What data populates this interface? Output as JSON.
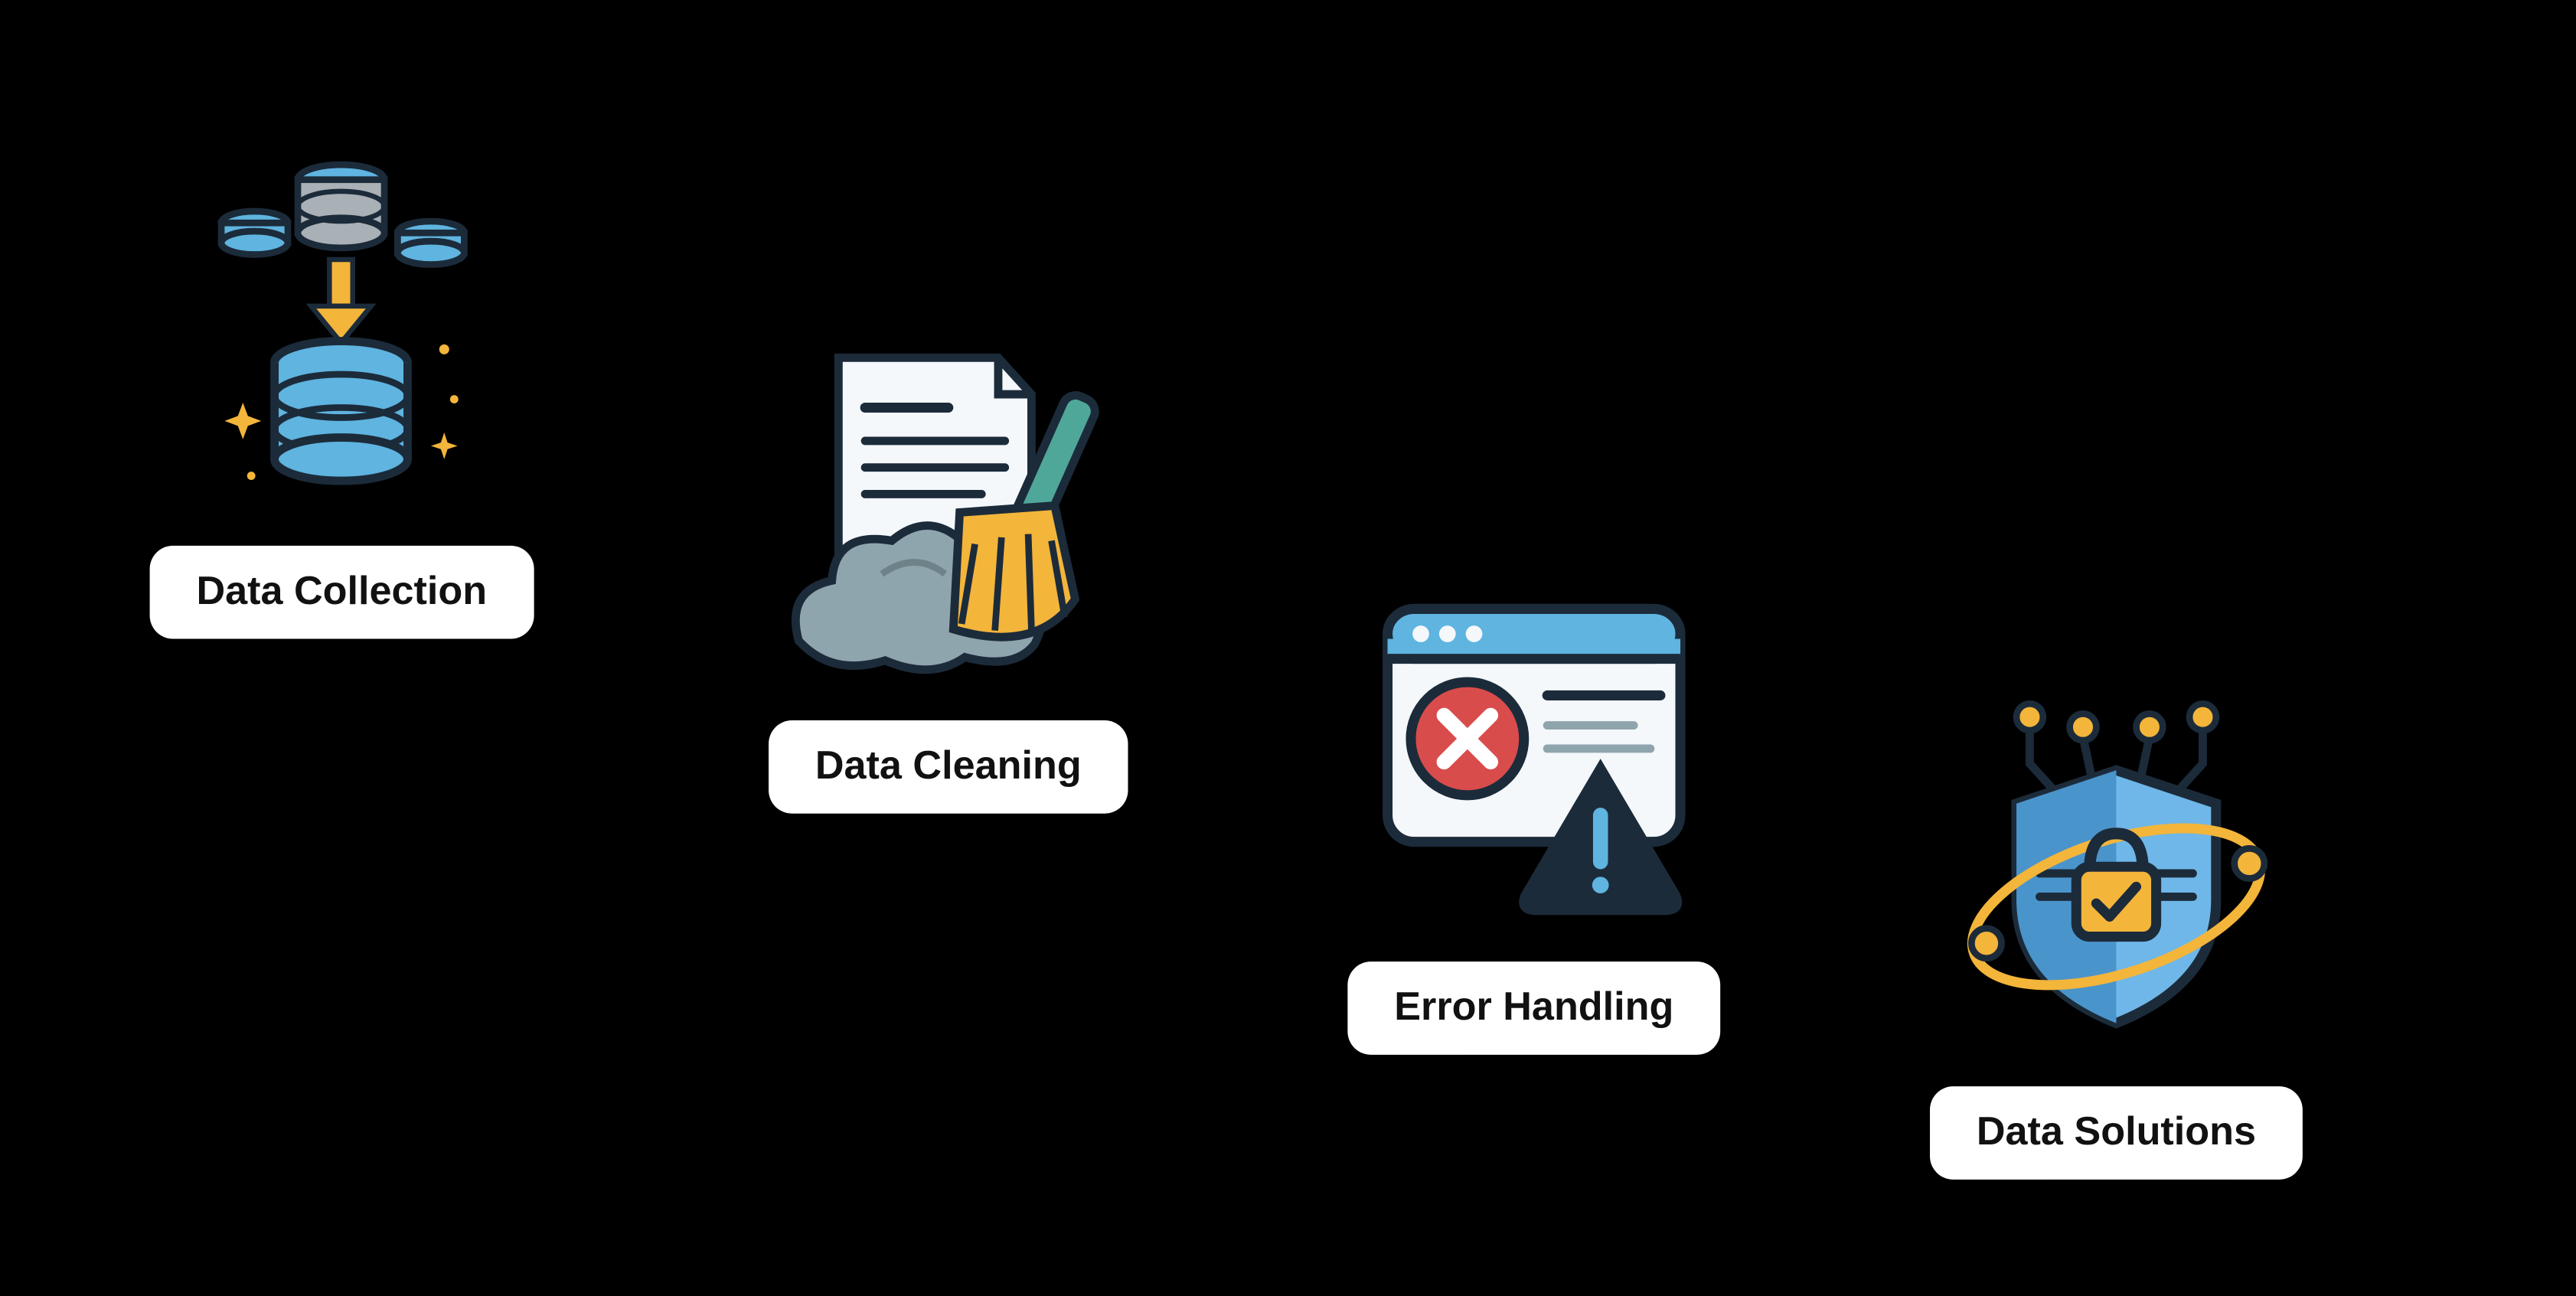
{
  "steps": [
    {
      "label": "Data Collection",
      "icon_name": "data-collection-icon"
    },
    {
      "label": "Data Cleaning",
      "icon_name": "data-cleaning-icon"
    },
    {
      "label": "Error Handling",
      "icon_name": "error-handling-icon"
    },
    {
      "label": "Data Solutions",
      "icon_name": "data-solutions-icon"
    }
  ],
  "colors": {
    "background": "#000000",
    "pill_bg": "#ffffff",
    "pill_text": "#111111",
    "blue": "#5fb4e0",
    "blue_dark": "#3a95c6",
    "navy": "#1c2b3a",
    "yellow": "#f3b53a",
    "yellow_dark": "#d9931c",
    "doc_bg": "#f4f8fb",
    "gray": "#8fa5ad",
    "gray_dark": "#6d8289",
    "teal": "#4fa79a",
    "red": "#d94c4c",
    "shield": "#6fb7e8",
    "shield_dark": "#4a94cc"
  }
}
